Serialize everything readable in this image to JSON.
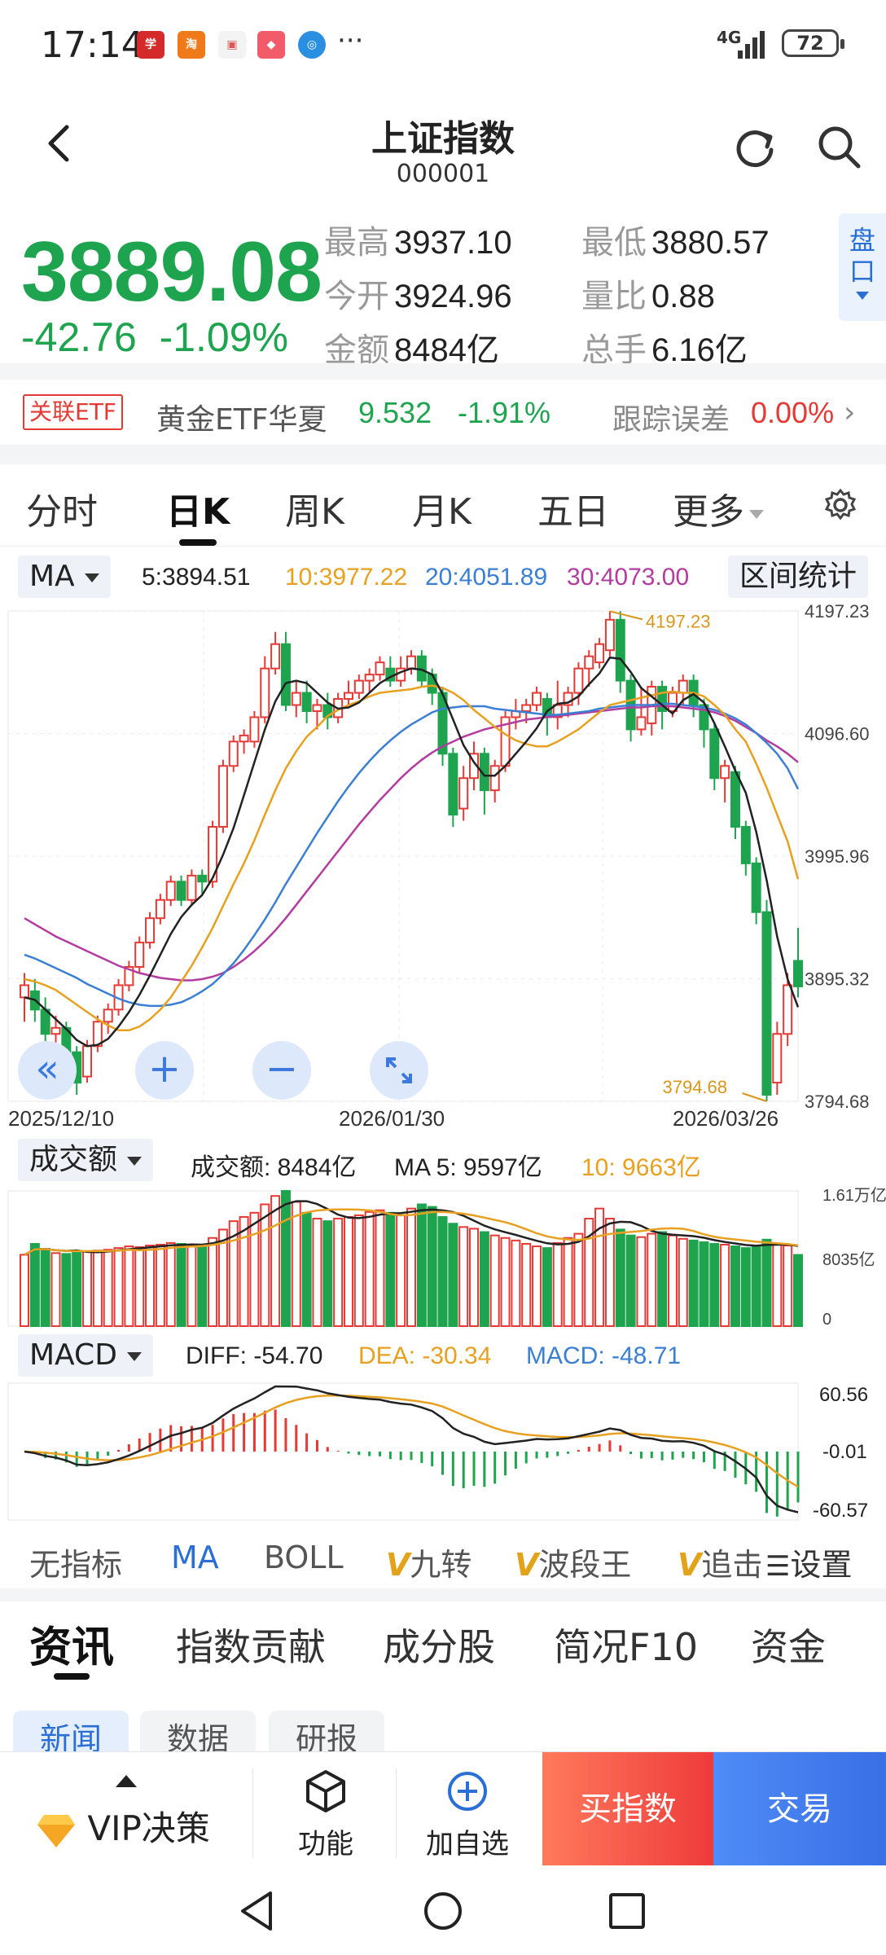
{
  "status": {
    "time": "17:14",
    "network": "4G",
    "battery": "72",
    "more": "···"
  },
  "header": {
    "title": "上证指数",
    "code": "000001"
  },
  "quote": {
    "price": "3889.08",
    "change": "-42.76",
    "change_pct": "-1.09%",
    "stats": [
      {
        "label": "最高",
        "value": "3937.10"
      },
      {
        "label": "最低",
        "value": "3880.57"
      },
      {
        "label": "今开",
        "value": "3924.96"
      },
      {
        "label": "量比",
        "value": "0.88"
      },
      {
        "label": "金额",
        "value": "8484亿"
      },
      {
        "label": "总手",
        "value": "6.16亿"
      }
    ],
    "pankou": "盘口"
  },
  "etf": {
    "badge": "关联ETF",
    "name": "黄金ETF华夏",
    "price": "9.532",
    "pct": "-1.91%",
    "tracking_label": "跟踪误差",
    "tracking_value": "0.00%"
  },
  "tabs": [
    "分时",
    "日K",
    "周K",
    "月K",
    "五日",
    "更多"
  ],
  "ma_legend": {
    "selector": "MA",
    "ma5": "5:3894.51",
    "ma10": "10:3977.22",
    "ma20": "20:4051.89",
    "ma30": "30:4073.00",
    "range_stats": "区间统计"
  },
  "colors": {
    "up": "#e53935",
    "down": "#1ea44e",
    "ma5": "#222222",
    "ma10": "#e8a020",
    "ma20": "#3b7fd4",
    "ma30": "#b43ca0",
    "accent": "#2a6fd6"
  },
  "chart_data": [
    {
      "type": "candlestick",
      "y_ticks": [
        "4197.23",
        "4096.60",
        "3995.96",
        "3895.32",
        "3794.68"
      ],
      "ylim": [
        3794.68,
        4197.23
      ],
      "x_labels": [
        "2025/12/10",
        "2026/01/30",
        "2026/03/26"
      ],
      "annotations": {
        "high": "4197.23",
        "low": "3794.68"
      },
      "candles": [
        [
          3880,
          3890,
          3860,
          3900
        ],
        [
          3885,
          3870,
          3860,
          3895
        ],
        [
          3870,
          3850,
          3840,
          3880
        ],
        [
          3850,
          3855,
          3820,
          3865
        ],
        [
          3855,
          3835,
          3825,
          3860
        ],
        [
          3835,
          3810,
          3800,
          3840
        ],
        [
          3815,
          3840,
          3810,
          3845
        ],
        [
          3840,
          3860,
          3835,
          3865
        ],
        [
          3860,
          3870,
          3850,
          3875
        ],
        [
          3870,
          3890,
          3865,
          3895
        ],
        [
          3890,
          3905,
          3885,
          3910
        ],
        [
          3905,
          3925,
          3900,
          3930
        ],
        [
          3925,
          3945,
          3920,
          3950
        ],
        [
          3945,
          3960,
          3940,
          3965
        ],
        [
          3960,
          3975,
          3955,
          3980
        ],
        [
          3975,
          3960,
          3955,
          3980
        ],
        [
          3960,
          3980,
          3955,
          3985
        ],
        [
          3980,
          3975,
          3965,
          3985
        ],
        [
          3975,
          4020,
          3970,
          4025
        ],
        [
          4020,
          4070,
          4015,
          4075
        ],
        [
          4070,
          4090,
          4065,
          4095
        ],
        [
          4090,
          4095,
          4080,
          4100
        ],
        [
          4090,
          4110,
          4085,
          4115
        ],
        [
          4110,
          4150,
          4105,
          4160
        ],
        [
          4150,
          4170,
          4145,
          4180
        ],
        [
          4170,
          4120,
          4115,
          4180
        ],
        [
          4120,
          4130,
          4110,
          4140
        ],
        [
          4130,
          4115,
          4105,
          4140
        ],
        [
          4115,
          4120,
          4100,
          4125
        ],
        [
          4120,
          4110,
          4100,
          4130
        ],
        [
          4110,
          4125,
          4105,
          4130
        ],
        [
          4125,
          4130,
          4120,
          4140
        ],
        [
          4130,
          4140,
          4125,
          4145
        ],
        [
          4140,
          4145,
          4130,
          4150
        ],
        [
          4145,
          4155,
          4140,
          4160
        ],
        [
          4150,
          4140,
          4135,
          4160
        ],
        [
          4140,
          4150,
          4135,
          4160
        ],
        [
          4150,
          4160,
          4145,
          4165
        ],
        [
          4160,
          4140,
          4135,
          4165
        ],
        [
          4145,
          4130,
          4120,
          4150
        ],
        [
          4130,
          4080,
          4070,
          4135
        ],
        [
          4080,
          4030,
          4020,
          4085
        ],
        [
          4035,
          4060,
          4025,
          4070
        ],
        [
          4060,
          4080,
          4050,
          4090
        ],
        [
          4080,
          4050,
          4030,
          4085
        ],
        [
          4050,
          4070,
          4040,
          4075
        ],
        [
          4070,
          4110,
          4065,
          4115
        ],
        [
          4110,
          4115,
          4100,
          4125
        ],
        [
          4115,
          4120,
          4105,
          4125
        ],
        [
          4120,
          4130,
          4115,
          4135
        ],
        [
          4125,
          4110,
          4095,
          4130
        ],
        [
          4110,
          4120,
          4100,
          4140
        ],
        [
          4120,
          4130,
          4110,
          4135
        ],
        [
          4130,
          4150,
          4120,
          4155
        ],
        [
          4150,
          4160,
          4135,
          4165
        ],
        [
          4155,
          4170,
          4150,
          4175
        ],
        [
          4165,
          4190,
          4160,
          4197
        ],
        [
          4190,
          4140,
          4130,
          4197
        ],
        [
          4140,
          4100,
          4090,
          4145
        ],
        [
          4100,
          4110,
          4095,
          4135
        ],
        [
          4105,
          4135,
          4095,
          4140
        ],
        [
          4135,
          4115,
          4100,
          4140
        ],
        [
          4115,
          4130,
          4110,
          4135
        ],
        [
          4130,
          4140,
          4120,
          4145
        ],
        [
          4140,
          4120,
          4110,
          4145
        ],
        [
          4120,
          4100,
          4085,
          4125
        ],
        [
          4100,
          4060,
          4050,
          4105
        ],
        [
          4060,
          4070,
          4040,
          4075
        ],
        [
          4065,
          4020,
          4010,
          4070
        ],
        [
          4020,
          3990,
          3980,
          4025
        ],
        [
          3990,
          3950,
          3940,
          3995
        ],
        [
          3950,
          3800,
          3794.68,
          3960
        ],
        [
          3810,
          3850,
          3800,
          3860
        ],
        [
          3850,
          3890,
          3840,
          3900
        ],
        [
          3910,
          3889,
          3880,
          3937
        ]
      ],
      "ma5": [
        3880,
        3878,
        3870,
        3862,
        3854,
        3845,
        3840,
        3841,
        3846,
        3856,
        3868,
        3882,
        3898,
        3915,
        3932,
        3946,
        3956,
        3964,
        3978,
        3997,
        4019,
        4046,
        4073,
        4100,
        4123,
        4138,
        4140,
        4138,
        4130,
        4122,
        4117,
        4118,
        4122,
        4130,
        4138,
        4143,
        4147,
        4150,
        4149,
        4145,
        4129,
        4108,
        4087,
        4073,
        4062,
        4062,
        4070,
        4080,
        4090,
        4101,
        4115,
        4121,
        4122,
        4127,
        4137,
        4146,
        4159,
        4158,
        4147,
        4134,
        4127,
        4120,
        4113,
        4124,
        4129,
        4122,
        4105,
        4086,
        4066,
        4048,
        4016,
        3976,
        3930,
        3895,
        3872
      ],
      "ma10": [
        3895,
        3893,
        3890,
        3886,
        3880,
        3874,
        3868,
        3862,
        3857,
        3853,
        3853,
        3856,
        3862,
        3870,
        3880,
        3893,
        3906,
        3921,
        3937,
        3955,
        3973,
        3990,
        4009,
        4030,
        4050,
        4068,
        4082,
        4094,
        4102,
        4111,
        4116,
        4120,
        4123,
        4127,
        4130,
        4131,
        4132,
        4133,
        4135,
        4136,
        4134,
        4130,
        4124,
        4116,
        4109,
        4102,
        4096,
        4091,
        4088,
        4086,
        4086,
        4090,
        4095,
        4100,
        4107,
        4114,
        4120,
        4122,
        4124,
        4126,
        4128,
        4130,
        4131,
        4130,
        4130,
        4127,
        4120,
        4112,
        4100,
        4090,
        4072,
        4052,
        4030,
        4008,
        3977
      ],
      "ma20": [
        3915,
        3912,
        3908,
        3904,
        3900,
        3896,
        3891,
        3887,
        3883,
        3879,
        3876,
        3874,
        3873,
        3873,
        3874,
        3876,
        3880,
        3885,
        3891,
        3899,
        3908,
        3919,
        3931,
        3944,
        3958,
        3973,
        3987,
        4001,
        4015,
        4028,
        4041,
        4053,
        4064,
        4074,
        4083,
        4091,
        4098,
        4104,
        4109,
        4114,
        4117,
        4118,
        4119,
        4119,
        4119,
        4117,
        4116,
        4115,
        4114,
        4113,
        4112,
        4112,
        4113,
        4114,
        4115,
        4117,
        4118,
        4119,
        4120,
        4120,
        4120,
        4121,
        4121,
        4120,
        4119,
        4118,
        4116,
        4113,
        4109,
        4104,
        4097,
        4089,
        4080,
        4068,
        4051
      ],
      "ma30": [
        3945,
        3940,
        3935,
        3930,
        3926,
        3922,
        3918,
        3914,
        3910,
        3906,
        3903,
        3900,
        3898,
        3896,
        3895,
        3894,
        3894,
        3895,
        3897,
        3900,
        3905,
        3911,
        3918,
        3926,
        3935,
        3945,
        3956,
        3967,
        3978,
        3989,
        4000,
        4011,
        4022,
        4032,
        4042,
        4051,
        4060,
        4068,
        4075,
        4081,
        4086,
        4090,
        4094,
        4097,
        4100,
        4102,
        4104,
        4106,
        4108,
        4109,
        4110,
        4111,
        4112,
        4113,
        4114,
        4115,
        4116,
        4117,
        4118,
        4118,
        4119,
        4119,
        4119,
        4118,
        4117,
        4116,
        4114,
        4111,
        4107,
        4102,
        4097,
        4091,
        4086,
        4080,
        4073
      ]
    },
    {
      "type": "bar",
      "title": "成交额",
      "y_ticks": [
        "1.61万亿",
        "8035亿",
        "0"
      ],
      "values": [
        8500,
        9800,
        9200,
        8700,
        8600,
        8800,
        8900,
        9000,
        9100,
        9300,
        9500,
        9400,
        9600,
        9700,
        9900,
        9800,
        9600,
        9500,
        10500,
        11500,
        12500,
        13000,
        13500,
        14500,
        15500,
        16100,
        14800,
        13500,
        12800,
        12500,
        12800,
        13000,
        13200,
        13600,
        13800,
        13500,
        13200,
        14000,
        14500,
        14200,
        13000,
        12200,
        11800,
        11600,
        11200,
        10800,
        10500,
        10200,
        9800,
        9500,
        9300,
        9900,
        10500,
        11000,
        12800,
        14000,
        12800,
        11500,
        10800,
        10600,
        11000,
        11200,
        10800,
        10400,
        10200,
        10000,
        9800,
        9700,
        9500,
        9300,
        9600,
        10300,
        9800,
        9600,
        8484
      ],
      "ma5_label": "MA 5: 9597亿",
      "ma10_label": "10: 9663亿",
      "current_label": "成交额: 8484亿"
    },
    {
      "type": "macd",
      "title": "MACD",
      "y_ticks": [
        "60.56",
        "-0.01",
        "-60.57"
      ],
      "diff_label": "DIFF: -54.70",
      "dea_label": "DEA: -30.34",
      "macd_label": "MACD: -48.71"
    }
  ],
  "volume_legend": {
    "selector": "成交额",
    "current": "成交额: 8484亿",
    "ma5": "MA 5: 9597亿",
    "ma10": "10: 9663亿"
  },
  "macd_legend": {
    "selector": "MACD",
    "diff": "DIFF: -54.70",
    "dea": "DEA: -30.34",
    "macd": "MACD: -48.71"
  },
  "indicators": {
    "items": [
      "无指标",
      "MA",
      "BOLL"
    ],
    "v_items": [
      "九转",
      "波段王",
      "追击"
    ],
    "settings": "设置"
  },
  "info_tabs": [
    "资讯",
    "指数贡献",
    "成分股",
    "简况F10",
    "资金"
  ],
  "sub_tabs": [
    "新闻",
    "数据",
    "研报"
  ],
  "bottom_bar": {
    "vip": "VIP决策",
    "func": "功能",
    "add": "加自选",
    "buy": "买指数",
    "trade": "交易"
  }
}
